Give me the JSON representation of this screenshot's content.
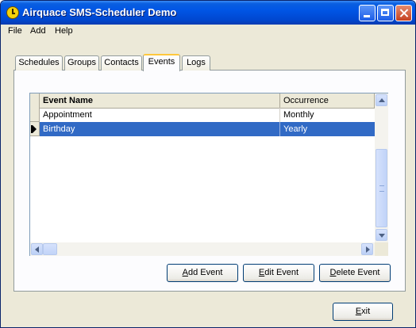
{
  "window": {
    "title": "Airquace SMS-Scheduler Demo"
  },
  "menu": {
    "items": [
      "File",
      "Add",
      "Help"
    ]
  },
  "tabs": [
    {
      "label": "Schedules"
    },
    {
      "label": "Groups"
    },
    {
      "label": "Contacts"
    },
    {
      "label": "Events",
      "active": true
    },
    {
      "label": "Logs"
    }
  ],
  "grid": {
    "columns": [
      "Event Name",
      "Occurrence"
    ],
    "rows": [
      {
        "name": "Appointment",
        "occurrence": "Monthly",
        "selected": false
      },
      {
        "name": "Birthday",
        "occurrence": "Yearly",
        "selected": true
      }
    ]
  },
  "buttons": {
    "add_event": {
      "accel": "A",
      "rest": "dd Event"
    },
    "edit_event": {
      "accel": "E",
      "rest": "dit Event"
    },
    "delete_event": {
      "accel": "D",
      "rest": "elete Event"
    },
    "exit": {
      "accel": "E",
      "rest": "xit"
    }
  },
  "colors": {
    "titlebar": "#0055e5",
    "selection": "#316ac5",
    "tab_highlight": "#ffc83c"
  }
}
